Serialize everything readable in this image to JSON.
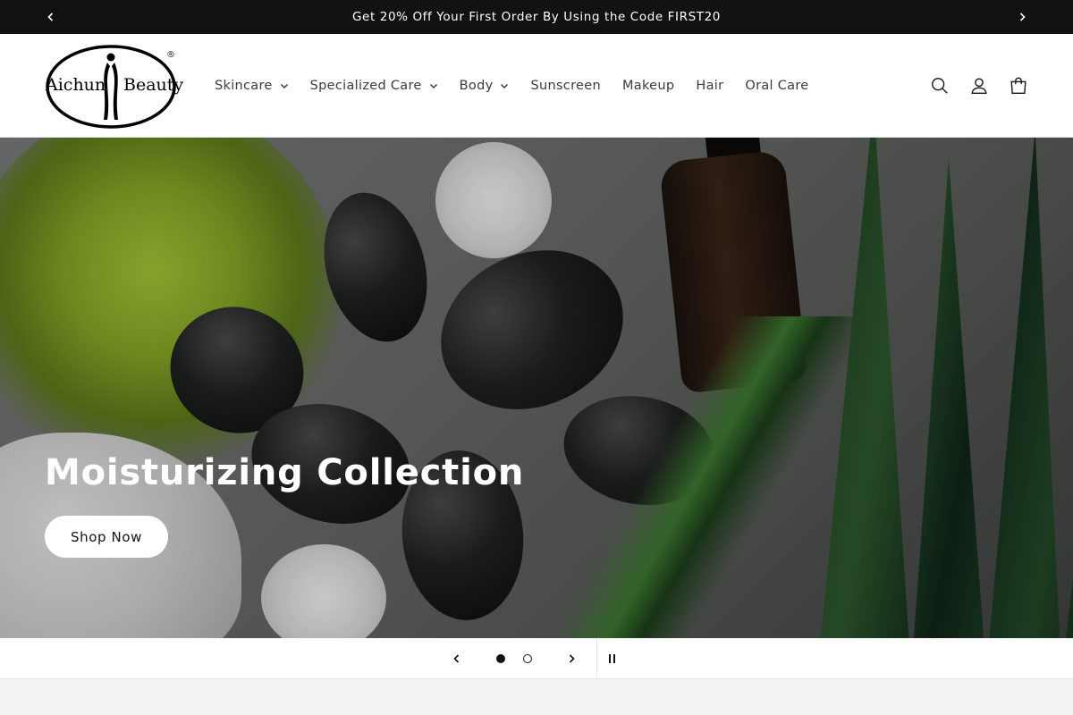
{
  "announcement": {
    "text": "Get 20% Off Your First Order By Using the Code FIRST20",
    "prev_icon": "chevron-left-icon",
    "next_icon": "chevron-right-icon"
  },
  "header": {
    "logo": {
      "left_word": "Aichun",
      "right_word": "Beauty",
      "registered_mark": "®"
    },
    "nav": [
      {
        "label": "Skincare",
        "has_dropdown": true
      },
      {
        "label": "Specialized Care",
        "has_dropdown": true
      },
      {
        "label": "Body",
        "has_dropdown": true
      },
      {
        "label": "Sunscreen",
        "has_dropdown": false
      },
      {
        "label": "Makeup",
        "has_dropdown": false
      },
      {
        "label": "Hair",
        "has_dropdown": false
      },
      {
        "label": "Oral Care",
        "has_dropdown": false
      }
    ],
    "icons": [
      "search-icon",
      "account-icon",
      "cart-icon"
    ]
  },
  "hero": {
    "title": "Moisturizing Collection",
    "button_label": "Shop Now"
  },
  "slider": {
    "slide_count": 2,
    "active_slide": 1
  },
  "colors": {
    "announcement_bg": "#121212",
    "text": "#121212",
    "button_bg": "#ffffff"
  }
}
